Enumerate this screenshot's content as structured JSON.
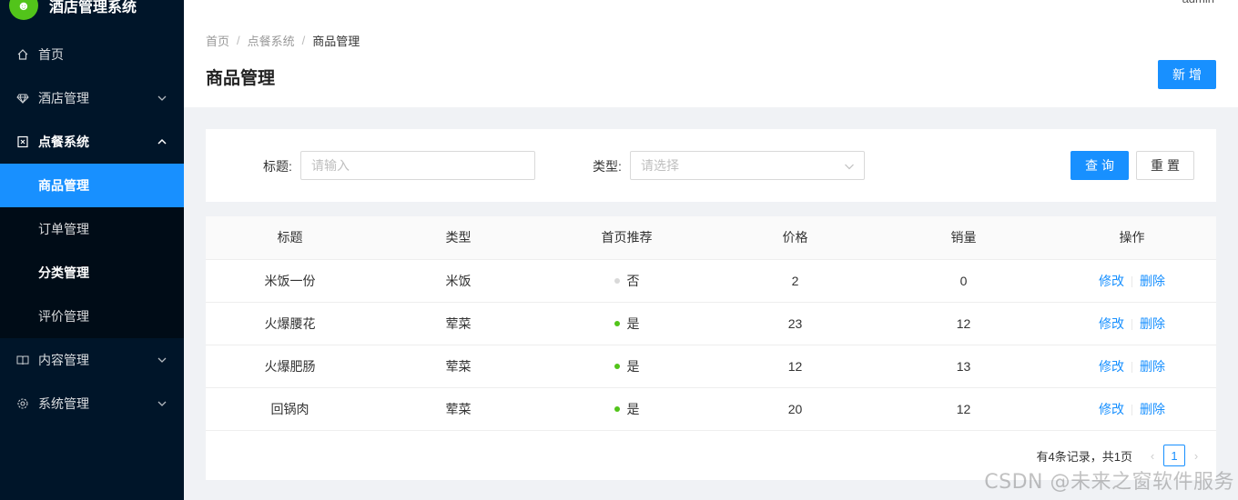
{
  "app": {
    "logo_glyph": "☻",
    "title": "酒店管理系统",
    "user": "admin"
  },
  "sidebar": {
    "items": [
      {
        "label": "首页",
        "icon": "home-icon"
      },
      {
        "label": "酒店管理",
        "icon": "diamond-icon"
      },
      {
        "label": "点餐系统",
        "icon": "order-icon"
      },
      {
        "label": "内容管理",
        "icon": "book-icon"
      },
      {
        "label": "系统管理",
        "icon": "gear-icon"
      }
    ],
    "sub_items": [
      {
        "label": "商品管理",
        "active": true
      },
      {
        "label": "订单管理"
      },
      {
        "label": "分类管理"
      },
      {
        "label": "评价管理"
      }
    ]
  },
  "breadcrumb": [
    "首页",
    "点餐系统",
    "商品管理"
  ],
  "breadcrumb_sep": "/",
  "page": {
    "title": "商品管理",
    "add_label": "新增"
  },
  "filter": {
    "title_label": "标题:",
    "title_placeholder": "请输入",
    "type_label": "类型:",
    "type_placeholder": "请选择",
    "query_label": "查询",
    "reset_label": "重置"
  },
  "table": {
    "columns": [
      "标题",
      "类型",
      "首页推荐",
      "价格",
      "销量",
      "操作"
    ],
    "rows": [
      {
        "title": "米饭一份",
        "type": "米饭",
        "recommend": "否",
        "recommended": false,
        "price": "2",
        "sales": "0"
      },
      {
        "title": "火爆腰花",
        "type": "荤菜",
        "recommend": "是",
        "recommended": true,
        "price": "23",
        "sales": "12"
      },
      {
        "title": "火爆肥肠",
        "type": "荤菜",
        "recommend": "是",
        "recommended": true,
        "price": "12",
        "sales": "13"
      },
      {
        "title": "回锅肉",
        "type": "荤菜",
        "recommend": "是",
        "recommended": true,
        "price": "20",
        "sales": "12"
      }
    ],
    "edit_label": "修改",
    "delete_label": "删除"
  },
  "pagination": {
    "total_text": "有4条记录，共1页",
    "current_page": "1",
    "prev": "‹",
    "next": "›"
  },
  "colors": {
    "sidebar_bg": "#001529",
    "primary": "#1890ff",
    "recommend_yes": "#52c41a",
    "recommend_no": "#d9d9d9"
  },
  "watermark": "CSDN @未来之窗软件服务"
}
